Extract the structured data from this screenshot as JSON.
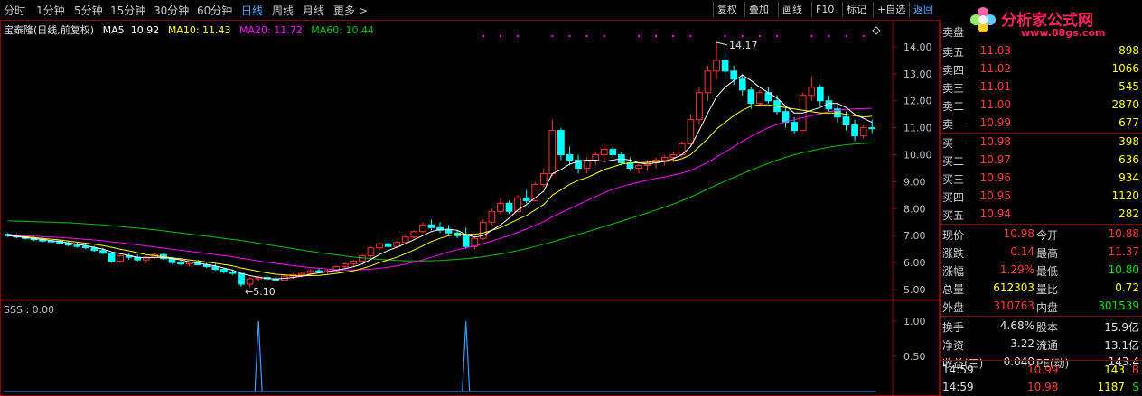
{
  "toolbar": {
    "periods": [
      "分时",
      "1分钟",
      "5分钟",
      "15分钟",
      "30分钟",
      "60分钟",
      "日线",
      "周线",
      "月线",
      "更多 >"
    ],
    "active_period": "日线",
    "right_buttons": [
      "复权",
      "叠加",
      "画线",
      "F10",
      "标记",
      "+自选",
      "返回"
    ]
  },
  "logo": {
    "brand": "分析家公式网",
    "url": "www.88gs.com"
  },
  "info": {
    "name": "宝泰隆(日线,前复权)",
    "ma5": "MA5: 10.92",
    "ma10": "MA10: 11.43",
    "ma20": "MA20: 11.72",
    "ma60": "MA60: 10.44"
  },
  "colors": {
    "ma5": "#ffffff",
    "ma10": "#ffff00",
    "ma20": "#ff00ff",
    "ma60": "#00c000",
    "up": "#ff3030",
    "down": "#00ffff"
  },
  "chart_data": {
    "type": "candlestick",
    "yaxis_ticks": [
      "14.00",
      "13.00",
      "12.00",
      "11.00",
      "10.00",
      "9.00",
      "8.00",
      "7.00",
      "6.00",
      "5.00"
    ],
    "ylim": [
      4.7,
      14.6
    ],
    "annotations": {
      "high": "14.17",
      "low": "←5.10"
    },
    "candles": [
      [
        7.05,
        7.1,
        6.95,
        7.0
      ],
      [
        7.0,
        7.05,
        6.9,
        6.95
      ],
      [
        6.95,
        7.0,
        6.85,
        6.9
      ],
      [
        6.9,
        6.98,
        6.8,
        6.85
      ],
      [
        6.85,
        6.95,
        6.75,
        6.8
      ],
      [
        6.8,
        6.9,
        6.7,
        6.78
      ],
      [
        6.8,
        6.85,
        6.7,
        6.72
      ],
      [
        6.72,
        6.8,
        6.6,
        6.65
      ],
      [
        6.65,
        6.75,
        6.55,
        6.6
      ],
      [
        6.6,
        6.7,
        6.5,
        6.55
      ],
      [
        6.55,
        6.62,
        6.4,
        6.45
      ],
      [
        6.45,
        6.55,
        6.3,
        6.35
      ],
      [
        6.35,
        6.4,
        6.0,
        6.05
      ],
      [
        6.05,
        6.3,
        6.0,
        6.25
      ],
      [
        6.25,
        6.35,
        6.1,
        6.2
      ],
      [
        6.2,
        6.3,
        6.05,
        6.1
      ],
      [
        6.1,
        6.25,
        6.0,
        6.2
      ],
      [
        6.2,
        6.35,
        6.15,
        6.3
      ],
      [
        6.3,
        6.35,
        6.1,
        6.15
      ],
      [
        6.15,
        6.2,
        5.95,
        6.0
      ],
      [
        6.0,
        6.1,
        5.9,
        5.95
      ],
      [
        5.95,
        6.05,
        5.85,
        6.0
      ],
      [
        6.0,
        6.1,
        5.9,
        5.92
      ],
      [
        5.92,
        6.0,
        5.8,
        5.85
      ],
      [
        5.85,
        5.95,
        5.7,
        5.75
      ],
      [
        5.75,
        5.8,
        5.6,
        5.65
      ],
      [
        5.65,
        5.75,
        5.55,
        5.6
      ],
      [
        5.6,
        5.62,
        5.1,
        5.2
      ],
      [
        5.2,
        5.45,
        5.1,
        5.4
      ],
      [
        5.4,
        5.5,
        5.3,
        5.45
      ],
      [
        5.45,
        5.55,
        5.35,
        5.4
      ],
      [
        5.4,
        5.5,
        5.3,
        5.35
      ],
      [
        5.35,
        5.55,
        5.3,
        5.5
      ],
      [
        5.5,
        5.6,
        5.4,
        5.55
      ],
      [
        5.55,
        5.65,
        5.45,
        5.6
      ],
      [
        5.6,
        5.75,
        5.55,
        5.7
      ],
      [
        5.7,
        5.8,
        5.6,
        5.65
      ],
      [
        5.65,
        5.75,
        5.55,
        5.7
      ],
      [
        5.7,
        5.9,
        5.65,
        5.85
      ],
      [
        5.85,
        6.0,
        5.8,
        5.95
      ],
      [
        5.95,
        6.1,
        5.85,
        6.05
      ],
      [
        6.05,
        6.3,
        6.0,
        6.25
      ],
      [
        6.25,
        6.6,
        6.2,
        6.55
      ],
      [
        6.55,
        6.75,
        6.45,
        6.7
      ],
      [
        6.7,
        6.85,
        6.55,
        6.6
      ],
      [
        6.6,
        6.8,
        6.55,
        6.75
      ],
      [
        6.75,
        7.0,
        6.7,
        6.95
      ],
      [
        6.95,
        7.2,
        6.9,
        7.15
      ],
      [
        7.15,
        7.5,
        7.1,
        7.4
      ],
      [
        7.4,
        7.6,
        7.2,
        7.3
      ],
      [
        7.3,
        7.5,
        7.1,
        7.2
      ],
      [
        7.2,
        7.4,
        7.0,
        7.1
      ],
      [
        7.1,
        7.2,
        6.9,
        7.0
      ],
      [
        7.0,
        7.3,
        6.5,
        6.6
      ],
      [
        6.6,
        7.0,
        6.5,
        6.9
      ],
      [
        6.9,
        7.6,
        6.85,
        7.5
      ],
      [
        7.5,
        8.0,
        7.4,
        7.9
      ],
      [
        7.9,
        8.4,
        7.8,
        8.2
      ],
      [
        8.2,
        8.3,
        7.8,
        7.9
      ],
      [
        7.9,
        8.5,
        7.85,
        8.4
      ],
      [
        8.4,
        8.7,
        8.2,
        8.3
      ],
      [
        8.3,
        9.0,
        8.25,
        8.9
      ],
      [
        8.9,
        9.5,
        8.8,
        9.3
      ],
      [
        9.3,
        11.3,
        9.2,
        10.9
      ],
      [
        10.9,
        11.0,
        9.8,
        10.0
      ],
      [
        10.0,
        10.3,
        9.6,
        9.8
      ],
      [
        9.8,
        10.0,
        9.3,
        9.5
      ],
      [
        9.5,
        9.9,
        9.3,
        9.8
      ],
      [
        9.8,
        10.1,
        9.6,
        10.0
      ],
      [
        10.0,
        10.4,
        9.8,
        10.2
      ],
      [
        10.2,
        10.3,
        9.9,
        10.0
      ],
      [
        10.0,
        10.1,
        9.6,
        9.7
      ],
      [
        9.7,
        9.9,
        9.4,
        9.5
      ],
      [
        9.5,
        9.7,
        9.3,
        9.6
      ],
      [
        9.6,
        9.8,
        9.4,
        9.7
      ],
      [
        9.7,
        9.9,
        9.5,
        9.8
      ],
      [
        9.8,
        10.0,
        9.6,
        9.9
      ],
      [
        9.9,
        10.1,
        9.7,
        10.0
      ],
      [
        10.0,
        10.5,
        9.9,
        10.4
      ],
      [
        10.4,
        11.5,
        10.3,
        11.3
      ],
      [
        11.3,
        12.5,
        11.1,
        12.3
      ],
      [
        12.3,
        13.3,
        12.0,
        13.1
      ],
      [
        13.1,
        14.17,
        12.8,
        13.5
      ],
      [
        13.5,
        13.8,
        12.9,
        13.1
      ],
      [
        13.1,
        13.3,
        12.6,
        12.8
      ],
      [
        12.8,
        13.0,
        12.2,
        12.4
      ],
      [
        12.4,
        12.5,
        11.7,
        11.9
      ],
      [
        11.9,
        12.4,
        11.8,
        12.3
      ],
      [
        12.3,
        12.5,
        11.9,
        12.0
      ],
      [
        12.0,
        12.2,
        11.5,
        11.6
      ],
      [
        11.6,
        11.8,
        11.0,
        11.2
      ],
      [
        11.2,
        11.4,
        10.8,
        10.9
      ],
      [
        10.9,
        12.3,
        10.9,
        12.2
      ],
      [
        12.2,
        12.9,
        12.0,
        12.5
      ],
      [
        12.5,
        12.6,
        11.8,
        12.0
      ],
      [
        12.0,
        12.2,
        11.6,
        11.7
      ],
      [
        11.7,
        11.9,
        11.2,
        11.4
      ],
      [
        11.4,
        11.6,
        10.9,
        11.1
      ],
      [
        11.1,
        11.3,
        10.5,
        10.7
      ],
      [
        10.7,
        11.1,
        10.6,
        11.0
      ],
      [
        11.0,
        11.3,
        10.8,
        10.98
      ]
    ],
    "ma5": [
      7.0,
      6.97,
      6.93,
      6.89,
      6.86,
      6.82,
      6.78,
      6.73,
      6.68,
      6.63,
      6.57,
      6.5,
      6.4,
      6.33,
      6.27,
      6.2,
      6.18,
      6.2,
      6.2,
      6.15,
      6.1,
      6.03,
      5.98,
      5.93,
      5.88,
      5.8,
      5.72,
      5.6,
      5.52,
      5.46,
      5.41,
      5.4,
      5.42,
      5.45,
      5.5,
      5.57,
      5.62,
      5.66,
      5.72,
      5.78,
      5.85,
      5.95,
      6.12,
      6.3,
      6.45,
      6.57,
      6.7,
      6.85,
      7.0,
      7.15,
      7.23,
      7.24,
      7.2,
      7.04,
      6.95,
      7.0,
      7.2,
      7.4,
      7.65,
      7.95,
      8.15,
      8.4,
      8.65,
      9.3,
      9.45,
      9.65,
      9.75,
      9.8,
      9.8,
      9.75,
      9.8,
      9.85,
      9.8,
      9.7,
      9.65,
      9.7,
      9.75,
      9.85,
      10.0,
      10.3,
      10.9,
      11.55,
      12.15,
      12.5,
      12.75,
      12.95,
      12.75,
      12.5,
      12.3,
      12.1,
      11.8,
      11.55,
      11.55,
      11.65,
      11.75,
      11.9,
      11.9,
      11.75,
      11.5,
      11.35,
      11.2
    ],
    "ma10": [
      7.0,
      6.98,
      6.96,
      6.93,
      6.9,
      6.87,
      6.84,
      6.8,
      6.76,
      6.72,
      6.68,
      6.63,
      6.57,
      6.5,
      6.44,
      6.37,
      6.3,
      6.26,
      6.22,
      6.18,
      6.14,
      6.1,
      6.06,
      6.02,
      5.98,
      5.93,
      5.88,
      5.8,
      5.74,
      5.68,
      5.62,
      5.57,
      5.55,
      5.52,
      5.51,
      5.52,
      5.53,
      5.56,
      5.6,
      5.65,
      5.7,
      5.78,
      5.88,
      6.0,
      6.1,
      6.2,
      6.33,
      6.47,
      6.62,
      6.78,
      6.9,
      7.0,
      7.05,
      7.05,
      7.05,
      7.1,
      7.2,
      7.3,
      7.45,
      7.6,
      7.75,
      7.95,
      8.15,
      8.5,
      8.7,
      8.9,
      9.05,
      9.15,
      9.3,
      9.45,
      9.55,
      9.65,
      9.7,
      9.7,
      9.72,
      9.75,
      9.75,
      9.78,
      9.85,
      10.0,
      10.3,
      10.6,
      10.95,
      11.2,
      11.45,
      11.65,
      11.8,
      11.85,
      11.85,
      11.8,
      11.75,
      11.7,
      11.65,
      11.6,
      11.55,
      11.55,
      11.55,
      11.5,
      11.45,
      11.4,
      11.43
    ],
    "ma20": [
      7.02,
      7.01,
      7.0,
      6.98,
      6.97,
      6.95,
      6.93,
      6.91,
      6.89,
      6.86,
      6.84,
      6.81,
      6.77,
      6.74,
      6.7,
      6.66,
      6.62,
      6.58,
      6.54,
      6.5,
      6.46,
      6.42,
      6.38,
      6.34,
      6.3,
      6.26,
      6.22,
      6.16,
      6.11,
      6.06,
      6.01,
      5.97,
      5.93,
      5.89,
      5.85,
      5.82,
      5.79,
      5.76,
      5.74,
      5.73,
      5.73,
      5.74,
      5.76,
      5.79,
      5.83,
      5.88,
      5.94,
      6.02,
      6.1,
      6.2,
      6.3,
      6.4,
      6.48,
      6.55,
      6.62,
      6.7,
      6.8,
      6.9,
      7.0,
      7.12,
      7.25,
      7.38,
      7.52,
      7.7,
      7.85,
      8.0,
      8.15,
      8.3,
      8.45,
      8.6,
      8.72,
      8.82,
      8.9,
      8.98,
      9.05,
      9.12,
      9.18,
      9.25,
      9.32,
      9.42,
      9.56,
      9.72,
      9.92,
      10.1,
      10.3,
      10.5,
      10.68,
      10.85,
      11.0,
      11.12,
      11.22,
      11.3,
      11.38,
      11.45,
      11.52,
      11.6,
      11.65,
      11.68,
      11.7,
      11.71,
      11.72
    ],
    "ma60": [
      7.55,
      7.54,
      7.53,
      7.52,
      7.51,
      7.5,
      7.49,
      7.48,
      7.46,
      7.44,
      7.42,
      7.4,
      7.37,
      7.34,
      7.31,
      7.28,
      7.25,
      7.22,
      7.18,
      7.14,
      7.1,
      7.06,
      7.02,
      6.98,
      6.94,
      6.9,
      6.86,
      6.82,
      6.77,
      6.72,
      6.67,
      6.62,
      6.57,
      6.52,
      6.47,
      6.42,
      6.37,
      6.33,
      6.29,
      6.25,
      6.21,
      6.18,
      6.15,
      6.12,
      6.1,
      6.08,
      6.07,
      6.06,
      6.06,
      6.07,
      6.08,
      6.1,
      6.12,
      6.15,
      6.18,
      6.22,
      6.27,
      6.32,
      6.38,
      6.45,
      6.52,
      6.6,
      6.68,
      6.77,
      6.86,
      6.95,
      7.04,
      7.14,
      7.24,
      7.34,
      7.44,
      7.54,
      7.64,
      7.74,
      7.84,
      7.95,
      8.06,
      8.17,
      8.3,
      8.43,
      8.58,
      8.73,
      8.88,
      9.02,
      9.16,
      9.3,
      9.43,
      9.56,
      9.68,
      9.8,
      9.9,
      10.0,
      10.08,
      10.15,
      10.22,
      10.28,
      10.33,
      10.37,
      10.4,
      10.42,
      10.44
    ],
    "sub_yticks": [
      "1.00",
      "0.50"
    ],
    "sss_label": "SSS : 0.00",
    "sss_peaks": [
      29,
      53
    ]
  },
  "quote": {
    "sell_header": "卖盘",
    "asks": [
      {
        "label": "卖五",
        "price": "11.03",
        "vol": "898"
      },
      {
        "label": "卖四",
        "price": "11.02",
        "vol": "1066"
      },
      {
        "label": "卖三",
        "price": "11.01",
        "vol": "545"
      },
      {
        "label": "卖二",
        "price": "11.00",
        "vol": "2870"
      },
      {
        "label": "卖一",
        "price": "10.99",
        "vol": "677"
      }
    ],
    "bids": [
      {
        "label": "买一",
        "price": "10.98",
        "vol": "398"
      },
      {
        "label": "买二",
        "price": "10.97",
        "vol": "636"
      },
      {
        "label": "买三",
        "price": "10.96",
        "vol": "934"
      },
      {
        "label": "买四",
        "price": "10.95",
        "vol": "1120"
      },
      {
        "label": "买五",
        "price": "10.94",
        "vol": "282"
      }
    ],
    "stats1": [
      {
        "k1": "现价",
        "v1": "10.98",
        "k2": "今开",
        "v2": "10.88"
      },
      {
        "k1": "涨跌",
        "v1": "0.14",
        "k2": "最高",
        "v2": "11.37"
      },
      {
        "k1": "涨幅",
        "v1": "1.29%",
        "k2": "最低",
        "v2": "10.80"
      },
      {
        "k1": "总量",
        "v1": "612303",
        "k2": "量比",
        "v2": "0.72"
      },
      {
        "k1": "外盘",
        "v1": "310763",
        "k2": "内盘",
        "v2": "301539"
      }
    ],
    "stats2": [
      {
        "k1": "换手",
        "v1": "4.68%",
        "k2": "股本",
        "v2": "15.9亿"
      },
      {
        "k1": "净资",
        "v1": "3.22",
        "k2": "流通",
        "v2": "13.1亿"
      },
      {
        "k1": "收益(三)",
        "v1": "0.040",
        "k2": "PE(动)",
        "v2": "143.4"
      }
    ],
    "ticks": [
      {
        "time": "14:59",
        "price": "10.99",
        "vol": "143",
        "dir": "B"
      },
      {
        "time": "14:59",
        "price": "10.98",
        "vol": "1187",
        "dir": "S"
      }
    ]
  }
}
